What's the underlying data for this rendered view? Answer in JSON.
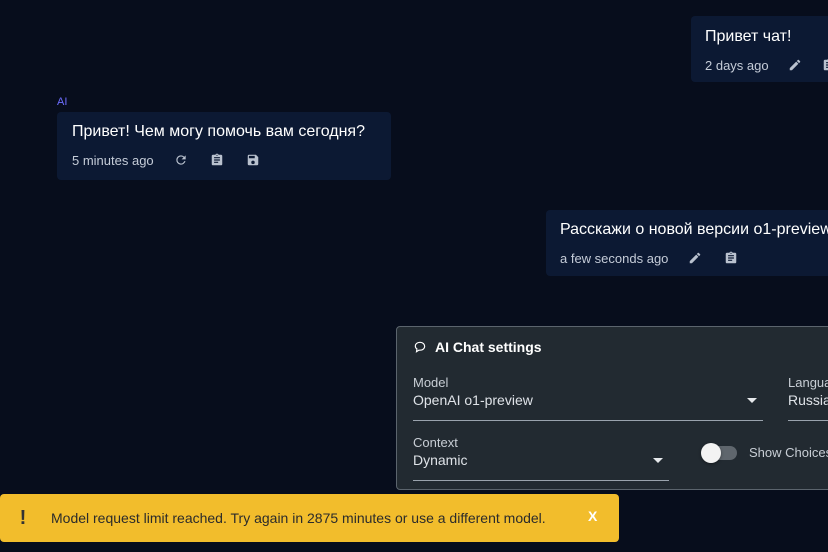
{
  "messages": [
    {
      "text": "Привет чат!",
      "time": "2 days ago"
    },
    {
      "sender": "AI",
      "text": "Привет! Чем могу помочь вам сегодня?",
      "time": "5 minutes ago"
    },
    {
      "text": "Расскажи о новой версии o1-preview",
      "time": "a few seconds ago"
    }
  ],
  "settings": {
    "title": "AI Chat settings",
    "model_label": "Model",
    "model_value": "OpenAI o1-preview",
    "language_label": "Language",
    "language_value": "Russian",
    "context_label": "Context",
    "context_value": "Dynamic",
    "show_choices_label": "Show Choices",
    "show_choices_on": false
  },
  "snackbar": {
    "icon": "!",
    "message": "Model request limit reached. Try again in 2875 minutes or use a different model.",
    "close_label": "X"
  },
  "colors": {
    "background": "#070d1c",
    "bubble": "#0c1933",
    "ai_label": "#6d6dff",
    "panel": "#222a31",
    "warning": "#f2bd2c"
  }
}
